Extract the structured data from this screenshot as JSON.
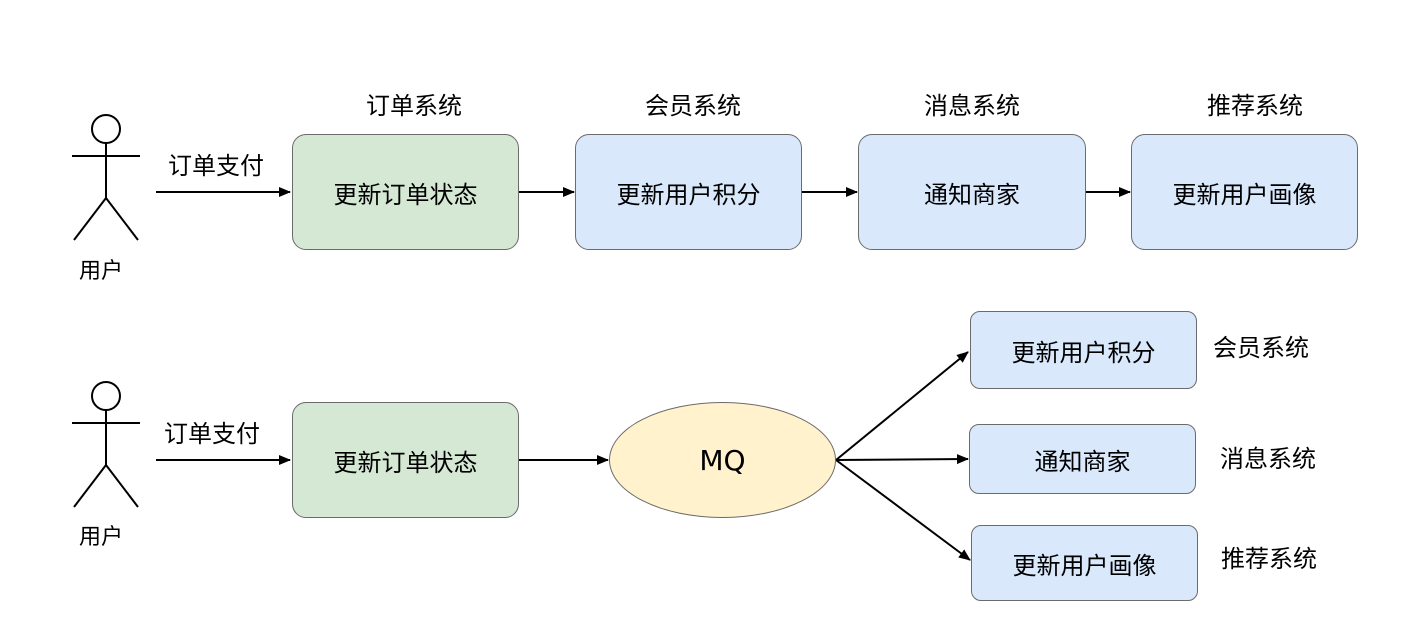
{
  "row1": {
    "actor_label": "用户",
    "action_label": "订单支付",
    "systems": [
      {
        "system": "订单系统",
        "task": "更新订单状态",
        "color": "#d5e8d4"
      },
      {
        "system": "会员系统",
        "task": "更新用户积分",
        "color": "#dae8fc"
      },
      {
        "system": "消息系统",
        "task": "通知商家",
        "color": "#dae8fc"
      },
      {
        "system": "推荐系统",
        "task": "更新用户画像",
        "color": "#dae8fc"
      }
    ]
  },
  "row2": {
    "actor_label": "用户",
    "action_label": "订单支付",
    "source_task": "更新订单状态",
    "queue_label": "MQ",
    "queue_color": "#fff2cc",
    "consumers": [
      {
        "task": "更新用户积分",
        "system": "会员系统"
      },
      {
        "task": "通知商家",
        "system": "消息系统"
      },
      {
        "task": "更新用户画像",
        "system": "推荐系统"
      }
    ]
  }
}
